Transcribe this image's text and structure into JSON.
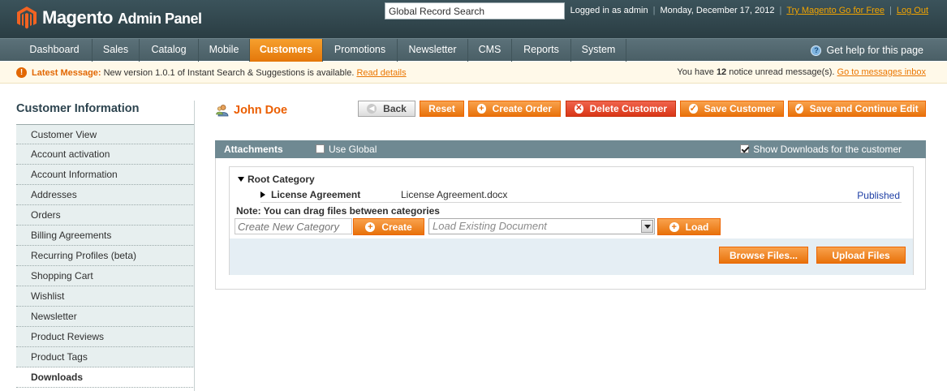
{
  "header": {
    "logo_brand": "Magento",
    "logo_sub": "Admin Panel",
    "search_value": "Global Record Search",
    "logged_in": "Logged in as admin",
    "date": "Monday, December 17, 2012",
    "try_link": "Try Magento Go for Free",
    "logout": "Log Out"
  },
  "nav": {
    "items": [
      "Dashboard",
      "Sales",
      "Catalog",
      "Mobile",
      "Customers",
      "Promotions",
      "Newsletter",
      "CMS",
      "Reports",
      "System"
    ],
    "active": "Customers",
    "help": "Get help for this page"
  },
  "notice": {
    "label": "Latest Message:",
    "text": "New version 1.0.1 of Instant Search & Suggestions is available.",
    "link": "Read details",
    "right_prefix": "You have",
    "count": "12",
    "right_suffix": "notice unread message(s).",
    "right_link": "Go to messages inbox"
  },
  "sidebar": {
    "title": "Customer Information",
    "items": [
      "Customer View",
      "Account activation",
      "Account Information",
      "Addresses",
      "Orders",
      "Billing Agreements",
      "Recurring Profiles (beta)",
      "Shopping Cart",
      "Wishlist",
      "Newsletter",
      "Product Reviews",
      "Product Tags",
      "Downloads"
    ],
    "active": "Downloads"
  },
  "page": {
    "customer_name": "John Doe",
    "buttons": {
      "back": "Back",
      "reset": "Reset",
      "create_order": "Create Order",
      "delete": "Delete Customer",
      "save": "Save Customer",
      "save_continue": "Save and Continue Edit"
    }
  },
  "attachments": {
    "title": "Attachments",
    "use_global": "Use Global",
    "use_global_checked": false,
    "show_downloads": "Show Downloads for the customer",
    "show_downloads_checked": true,
    "root_category": "Root Category",
    "category": "License Agreement",
    "file": "License Agreement.docx",
    "status": "Published",
    "note": "Note: You can drag files between categories",
    "new_category_placeholder": "Create New Category",
    "create_btn": "Create",
    "load_placeholder": "Load Existing Document",
    "load_btn": "Load",
    "browse_btn": "Browse Files...",
    "upload_btn": "Upload Files"
  }
}
